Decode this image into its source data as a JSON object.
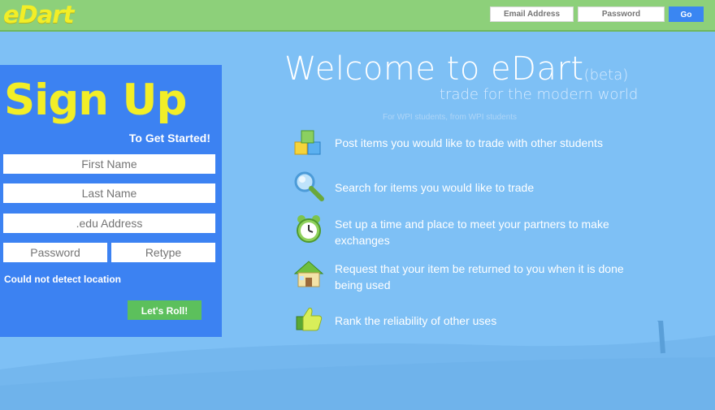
{
  "header": {
    "logo": "eDart",
    "email_placeholder": "Email Address",
    "password_placeholder": "Password",
    "go_label": "Go"
  },
  "signup": {
    "title": "Sign Up",
    "subtitle": "To Get Started!",
    "first_name_placeholder": "First Name",
    "last_name_placeholder": "Last Name",
    "edu_placeholder": ".edu Address",
    "password_placeholder": "Password",
    "retype_placeholder": "Retype",
    "location_status": "Could not detect location",
    "submit_label": "Let's Roll!"
  },
  "welcome": {
    "title": "Welcome to eDart",
    "beta": "(beta)",
    "tagline": "trade for the modern world",
    "audience": "For WPI students, from WPI students"
  },
  "features": [
    {
      "icon": "cubes-icon",
      "text": "Post items you would like to trade with other students"
    },
    {
      "icon": "magnifier-icon",
      "text": "Search for items you would like to trade"
    },
    {
      "icon": "alarm-clock-icon",
      "text": "Set up a time and place to meet your partners to make exchanges"
    },
    {
      "icon": "house-icon",
      "text": "Request that your item be returned to you when it is done being used"
    },
    {
      "icon": "thumbs-up-icon",
      "text": "Rank the reliability of other uses"
    }
  ],
  "colors": {
    "topbar": "#8dd07a",
    "background": "#7ec0f5",
    "signup_panel": "#3c82f2",
    "logo_yellow": "#f2ee27",
    "go_button": "#3a86f2",
    "roll_button": "#5cc05c"
  }
}
